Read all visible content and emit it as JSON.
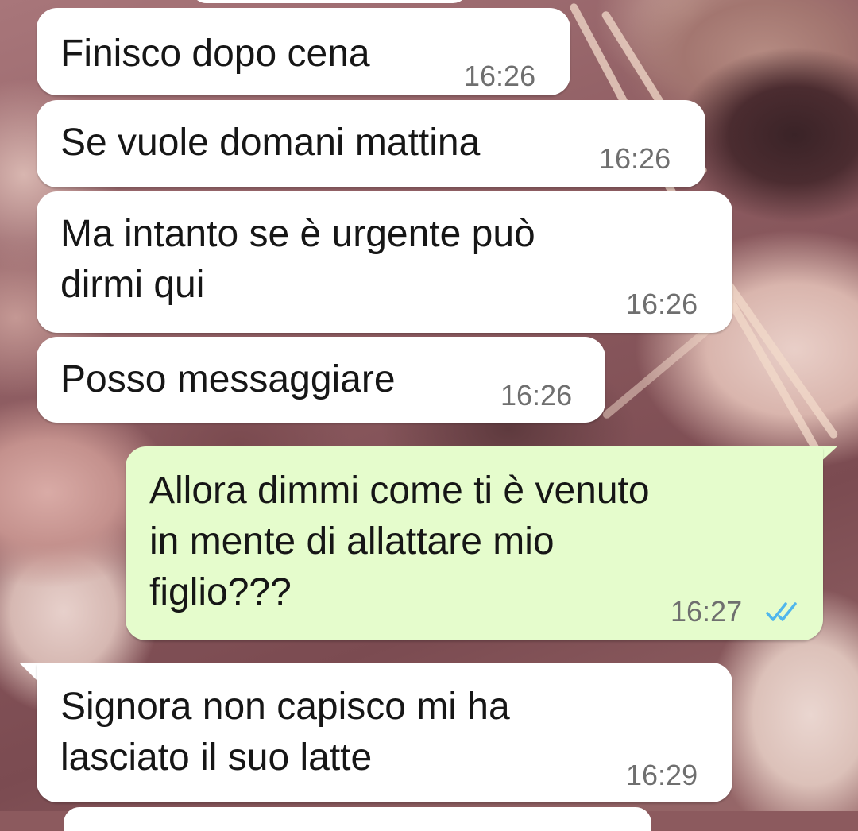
{
  "conversation": {
    "messages": [
      {
        "direction": "incoming",
        "text": "Finisco dopo cena",
        "time": "16:26"
      },
      {
        "direction": "incoming",
        "text": "Se vuole domani mattina",
        "time": "16:26"
      },
      {
        "direction": "incoming",
        "text": "Ma intanto se è urgente può\ndirmi qui",
        "time": "16:26"
      },
      {
        "direction": "incoming",
        "text": "Posso messaggiare",
        "time": "16:26"
      },
      {
        "direction": "outgoing",
        "text": "Allora dimmi come ti è venuto\nin mente di allattare mio\nfiglio???",
        "time": "16:27",
        "status_icon": "double-check-icon",
        "status": "read"
      },
      {
        "direction": "incoming",
        "text": "Signora non capisco mi ha\nlasciato il suo latte",
        "time": "16:29"
      }
    ]
  },
  "colors": {
    "incoming_bubble": "#ffffff",
    "outgoing_bubble": "#e5fccc",
    "text": "#161616",
    "timestamp": "#6f6f6f",
    "read_ticks": "#4fb6ec"
  }
}
